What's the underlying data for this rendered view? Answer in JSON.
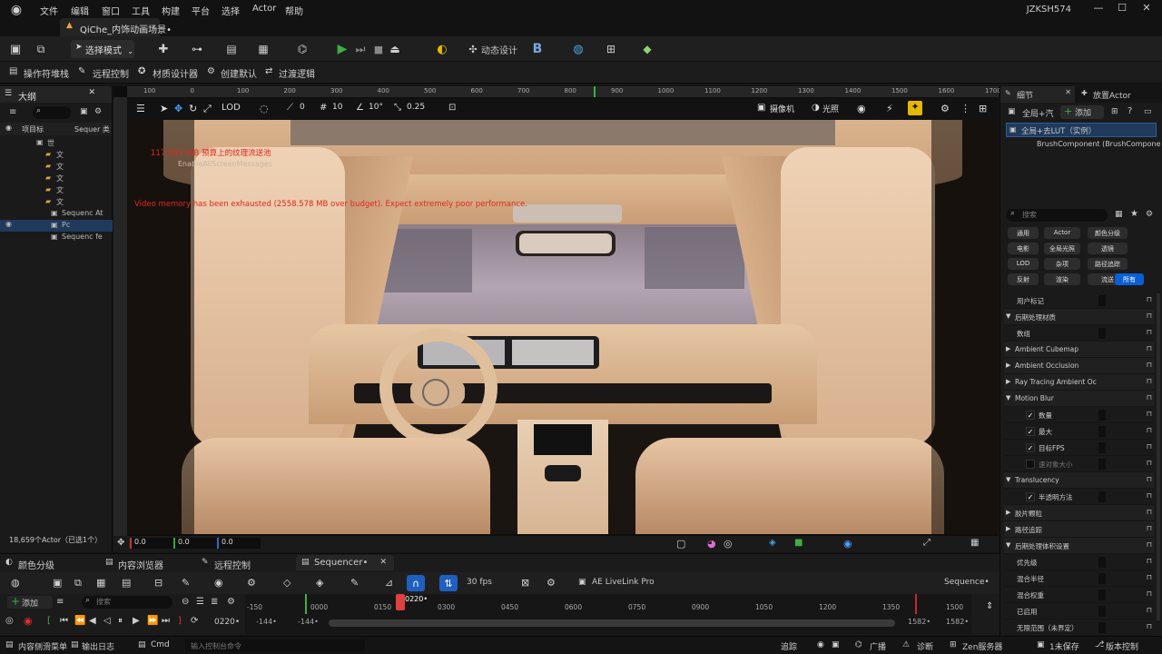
{
  "menu": {
    "items": [
      "文件",
      "编辑",
      "窗口",
      "工具",
      "构建",
      "平台",
      "选择",
      "Actor",
      "帮助"
    ],
    "document_tab": "QiChe_内饰动画场景•",
    "user": "JZKSH574"
  },
  "toolbar": {
    "mode_label": "选择模式",
    "dynamic_design": "动态设计"
  },
  "toolbar2": {
    "items": [
      "操作符堆栈",
      "远程控制",
      "材质设计器",
      "创建默认",
      "过渡逻辑"
    ]
  },
  "outliner": {
    "tab": "大纲",
    "col_label": "项目标",
    "col_type": "Sequer 类",
    "rows": [
      "世",
      "文",
      "文",
      "文",
      "文",
      "文",
      "Sequenc At",
      "Pc",
      "Sequenc fe"
    ],
    "actor_count": "18,659个Actor（已选1个）"
  },
  "viewport": {
    "ruler": [
      "100",
      "0",
      "100",
      "200",
      "300",
      "400",
      "500",
      "600",
      "700",
      "800",
      "900",
      "1000",
      "1100",
      "1200",
      "1300",
      "1400",
      "1500",
      "1600",
      "1700"
    ],
    "snap_values": [
      "0",
      "10",
      "10°",
      "0.25"
    ],
    "camera_label": "摄像机",
    "lit_label": "光照",
    "warnings": {
      "memory": "117.863 MiB 预算上的纹理流送池",
      "screen": "EnableAllScreenMessages",
      "video": "Video memory has been exhausted (2558.578 MB over budget). Expect extremely poor performance."
    },
    "coords": [
      "0.0",
      "0.0",
      "0.0"
    ]
  },
  "details": {
    "tabs": [
      "细节",
      "放置Actor"
    ],
    "actor_name": "全局+汽",
    "add_label": "添加",
    "selected": "全局+去LUT（实例）",
    "component": "BrushComponent (BrushCompone",
    "search_placeholder": "搜索",
    "filters": [
      "通用",
      "Actor",
      "颜色分级",
      "电影",
      "全局光照",
      "透镜",
      "LOD",
      "杂项",
      "路径追踪",
      "反射",
      "渲染",
      "流送",
      "所有"
    ],
    "props": [
      {
        "label": "用户标记",
        "type": "sub"
      },
      {
        "label": "后期处理材质",
        "type": "cat"
      },
      {
        "label": "数组",
        "type": "sub"
      },
      {
        "label": "Ambient Cubemap",
        "type": "cat"
      },
      {
        "label": "Ambient Occlusion",
        "type": "cat"
      },
      {
        "label": "Ray Tracing Ambient Oc",
        "type": "cat"
      },
      {
        "label": "Motion Blur",
        "type": "cat"
      },
      {
        "label": "数量",
        "type": "check"
      },
      {
        "label": "最大",
        "type": "check"
      },
      {
        "label": "目标FPS",
        "type": "check"
      },
      {
        "label": "速对象大小",
        "type": "uncheck"
      },
      {
        "label": "Translucency",
        "type": "cat"
      },
      {
        "label": "半透明方法",
        "type": "check"
      },
      {
        "label": "胶片颗粒",
        "type": "cat"
      },
      {
        "label": "路径追踪",
        "type": "cat"
      },
      {
        "label": "后期处理体积设置",
        "type": "cat"
      },
      {
        "label": "优先级",
        "type": "sub"
      },
      {
        "label": "混合半径",
        "type": "sub"
      },
      {
        "label": "混合权重",
        "type": "sub"
      },
      {
        "label": "已启用",
        "type": "sub"
      },
      {
        "label": "无限范围（未界定）",
        "type": "sub"
      }
    ]
  },
  "sequencer": {
    "tabs": [
      "颜色分级",
      "内容浏览器",
      "远程控制",
      "Sequencer•"
    ],
    "fps": "30 fps",
    "livelink": "AE LiveLink Pro",
    "seq_name": "Sequence•",
    "add_label": "添加",
    "search_placeholder": "搜索",
    "current_frame": "0220•",
    "playhead_frame": "0220•",
    "ticks": [
      "-150",
      "0000",
      "0150",
      "0300",
      "0450",
      "0600",
      "0750",
      "0900",
      "1050",
      "1200",
      "1350",
      "1500"
    ],
    "range_start": "-144•",
    "range_start2": "-144•",
    "range_end": "1582•",
    "range_end2": "1582•"
  },
  "status": {
    "content_drawer": "内容侧滑菜单",
    "output_log": "输出日志",
    "cmd": "Cmd",
    "cmd_placeholder": "输入控制台命令",
    "trace": "追踪",
    "broadcast": "广播",
    "diagnose": "诊断",
    "zen": "Zen服务器",
    "unsaved": "1未保存",
    "source_control": "版本控制"
  }
}
